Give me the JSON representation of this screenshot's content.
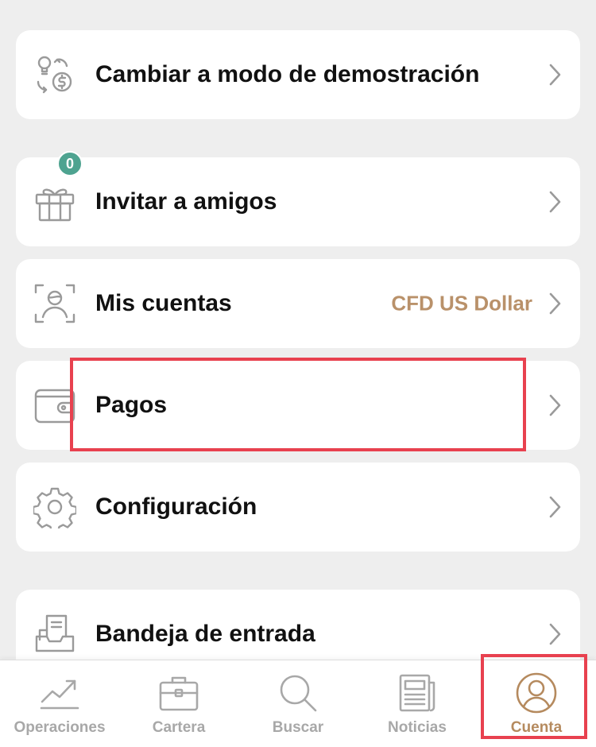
{
  "menu": {
    "demo": {
      "label": "Cambiar a modo de demostración"
    },
    "invite": {
      "label": "Invitar a amigos",
      "badge": "0"
    },
    "accounts": {
      "label": "Mis cuentas",
      "value": "CFD US Dollar"
    },
    "payments": {
      "label": "Pagos"
    },
    "settings": {
      "label": "Configuración"
    },
    "inbox": {
      "label": "Bandeja de entrada"
    }
  },
  "tabbar": {
    "operations": "Operaciones",
    "portfolio": "Cartera",
    "search": "Buscar",
    "news": "Noticias",
    "account": "Cuenta"
  },
  "colors": {
    "accent": "#b58a5e",
    "value_text": "#b9916a",
    "badge": "#4ea390",
    "highlight": "#e8414f",
    "inactive_tab": "#a8a8a8",
    "icon_gray": "#9a9a9a",
    "background": "#eeeeee"
  },
  "icons": {
    "demo": "bulb-dollar-swap-icon",
    "invite": "gift-icon",
    "accounts": "user-scan-icon",
    "payments": "wallet-icon",
    "settings": "gear-icon",
    "inbox": "inbox-tray-icon",
    "chevron": "chevron-right-icon",
    "operations": "trend-chart-icon",
    "portfolio": "briefcase-icon",
    "search": "search-icon",
    "news": "newspaper-icon",
    "account": "user-circle-icon"
  }
}
